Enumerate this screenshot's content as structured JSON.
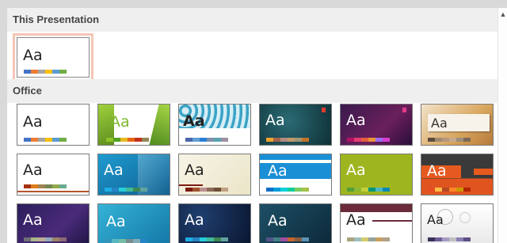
{
  "sections": {
    "this_presentation": "This Presentation",
    "office": "Office"
  },
  "thumb_text": "Aa",
  "swatches": {
    "office": [
      "#4472c4",
      "#ed7d31",
      "#a5a5a5",
      "#ffc000",
      "#5b9bd5",
      "#70ad47"
    ],
    "facet": [
      "#90c226",
      "#54a021",
      "#e6b91e",
      "#e76618",
      "#c42f1a",
      "#918655"
    ],
    "ion": [
      "#4a66ac",
      "#629dd1",
      "#297fd5",
      "#7f8fa9",
      "#5aa2ae",
      "#9d90a0"
    ],
    "teal": [
      "#f0a22e",
      "#a5644e",
      "#b58b80",
      "#c3986d",
      "#a19574",
      "#c17529"
    ],
    "purple": [
      "#b31166",
      "#e33d6f",
      "#e45f3c",
      "#e9943a",
      "#9b6bf2",
      "#d53dd0"
    ],
    "wood": [
      "#5c4c3e",
      "#a18870",
      "#b5977e",
      "#c6a98b",
      "#9c8f7a",
      "#7a6a55"
    ],
    "rust": [
      "#a53010",
      "#de7e18",
      "#9f8351",
      "#728653",
      "#92aa4c",
      "#6aac91"
    ],
    "blue1": [
      "#1cade4",
      "#2683c6",
      "#27ced7",
      "#42ba97",
      "#3e8853",
      "#62a39f"
    ],
    "cream": [
      "#7d1b12",
      "#a0522d",
      "#bc8f8f",
      "#8b6b5b",
      "#6f4e37",
      "#c0a080"
    ],
    "blueband": [
      "#0f6fc6",
      "#009dd9",
      "#0bd0d9",
      "#10cf9b",
      "#7cca62",
      "#a5c249"
    ],
    "green": [
      "#549e39",
      "#8ab833",
      "#c0cf3a",
      "#029676",
      "#4ab5c4",
      "#0989b1"
    ],
    "orange": [
      "#e84c22",
      "#ffbd47",
      "#b64926",
      "#ff8427",
      "#cc9900",
      "#b22600"
    ],
    "darkpurple": [
      "#6f6f74",
      "#a7b789",
      "#beae98",
      "#92a9b9",
      "#9c8265",
      "#8d6974"
    ],
    "skyblue": [
      "#3494ba",
      "#58b6c0",
      "#75bda7",
      "#7a8c8e",
      "#84acb6",
      "#2683c6"
    ],
    "navy": [
      "#1cade4",
      "#2683c6",
      "#27ced7",
      "#42ba97",
      "#3e8853",
      "#62a39f"
    ],
    "darkteal": [
      "#53548a",
      "#438086",
      "#a04da3",
      "#c4652d",
      "#8b5d3d",
      "#5c92b5"
    ],
    "mauve": [
      "#a9a57c",
      "#9cbebd",
      "#d2cb6c",
      "#95a39d",
      "#c89f5d",
      "#b1a089"
    ],
    "white2": [
      "#3b3059",
      "#6d5f96",
      "#a69bc4",
      "#c0c0c0",
      "#8a7fb0",
      "#5d4e85"
    ]
  }
}
